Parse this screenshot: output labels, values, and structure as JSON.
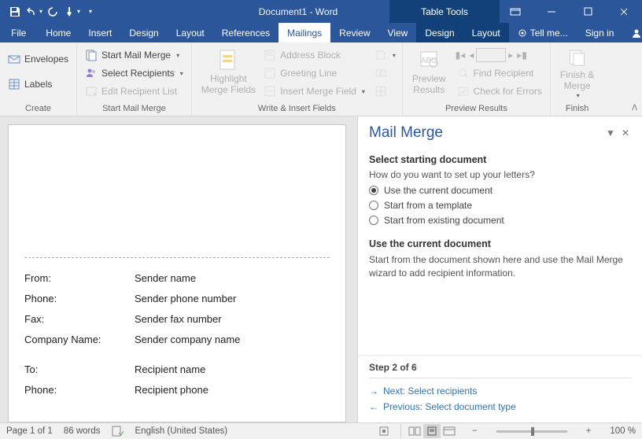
{
  "title": "Document1 - Word",
  "context_title": "Table Tools",
  "win": {
    "ribbon_options": "▾"
  },
  "tabs": {
    "file": "File",
    "home": "Home",
    "insert": "Insert",
    "design": "Design",
    "layout": "Layout",
    "references": "References",
    "mailings": "Mailings",
    "review": "Review",
    "view": "View",
    "ctx_design": "Design",
    "ctx_layout": "Layout",
    "tell": "Tell me...",
    "signin": "Sign in",
    "share": "Share"
  },
  "ribbon": {
    "create": {
      "label": "Create",
      "envelopes": "Envelopes",
      "labels": "Labels"
    },
    "start": {
      "label": "Start Mail Merge",
      "start": "Start Mail Merge",
      "select": "Select Recipients",
      "edit": "Edit Recipient List"
    },
    "write": {
      "label": "Write & Insert Fields",
      "highlight": "Highlight\nMerge Fields",
      "address": "Address Block",
      "greeting": "Greeting Line",
      "insert": "Insert Merge Field"
    },
    "preview": {
      "label": "Preview Results",
      "preview": "Preview\nResults",
      "find": "Find Recipient",
      "check": "Check for Errors"
    },
    "finish": {
      "label": "Finish",
      "finish": "Finish &\nMerge"
    }
  },
  "doc": {
    "from": {
      "l": "From:",
      "v": "Sender name"
    },
    "phone": {
      "l": "Phone:",
      "v": "Sender phone number"
    },
    "fax": {
      "l": "Fax:",
      "v": "Sender fax number"
    },
    "company": {
      "l": "Company Name:",
      "v": "Sender company name"
    },
    "to": {
      "l": "To:",
      "v": "Recipient name"
    },
    "rphone": {
      "l": "Phone:",
      "v": "Recipient phone"
    }
  },
  "pane": {
    "title": "Mail Merge",
    "h1": "Select starting document",
    "q": "How do you want to set up your letters?",
    "r1": "Use the current document",
    "r2": "Start from a template",
    "r3": "Start from existing document",
    "h2": "Use the current document",
    "desc": "Start from the document shown here and use the Mail Merge wizard to add recipient information.",
    "step": "Step 2 of 6",
    "next": "Next: Select recipients",
    "prev": "Previous: Select document type"
  },
  "status": {
    "page": "Page 1 of 1",
    "words": "86 words",
    "lang": "English (United States)",
    "zoom": "100 %"
  }
}
